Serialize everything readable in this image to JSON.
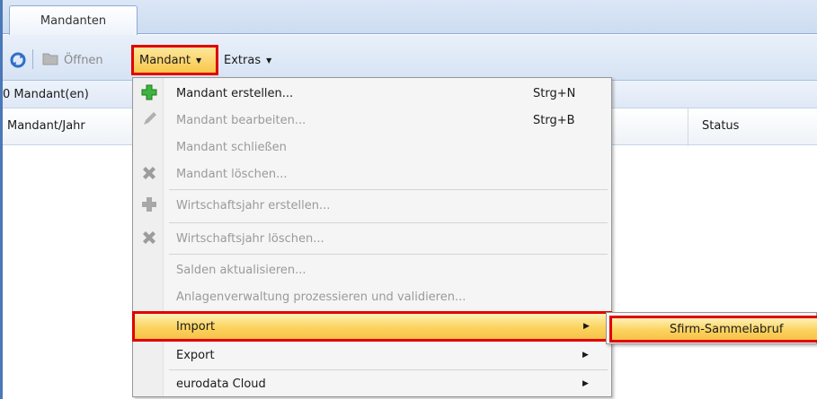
{
  "tabs": [
    {
      "label": "Mandanten"
    }
  ],
  "toolbar": {
    "open_label": "Öffnen",
    "mandant_label": "Mandant",
    "extras_label": "Extras"
  },
  "list": {
    "count_label": "0 Mandant(en)",
    "columns": [
      "Mandant/Jahr",
      "Status"
    ]
  },
  "menu": {
    "items": [
      {
        "label": "Mandant erstellen...",
        "shortcut": "Strg+N",
        "enabled": true,
        "icon": "green-plus-icon"
      },
      {
        "label": "Mandant bearbeiten...",
        "shortcut": "Strg+B",
        "enabled": false,
        "icon": "pencil-icon"
      },
      {
        "label": "Mandant schließen",
        "shortcut": "",
        "enabled": false,
        "icon": ""
      },
      {
        "label": "Mandant löschen...",
        "shortcut": "",
        "enabled": false,
        "icon": "delete-x-icon"
      },
      {
        "label": "Wirtschaftsjahr erstellen...",
        "shortcut": "",
        "enabled": false,
        "icon": "gray-plus-icon"
      },
      {
        "label": "Wirtschaftsjahr löschen...",
        "shortcut": "",
        "enabled": false,
        "icon": "delete-x-icon"
      },
      {
        "label": "Salden aktualisieren...",
        "shortcut": "",
        "enabled": false,
        "icon": ""
      },
      {
        "label": "Anlagenverwaltung prozessieren und validieren...",
        "shortcut": "",
        "enabled": false,
        "icon": ""
      },
      {
        "label": "Import",
        "submenu": true,
        "enabled": true,
        "highlighted": true
      },
      {
        "label": "Export",
        "submenu": true,
        "enabled": true
      },
      {
        "label": "eurodata Cloud",
        "submenu": true,
        "enabled": true
      }
    ]
  },
  "submenu": {
    "items": [
      {
        "label": "Sfirm-Sammelabruf"
      }
    ]
  },
  "colors": {
    "highlight_border": "#e00000",
    "highlight_fill": "#fbd35e",
    "chrome_blue": "#4a78b8"
  }
}
